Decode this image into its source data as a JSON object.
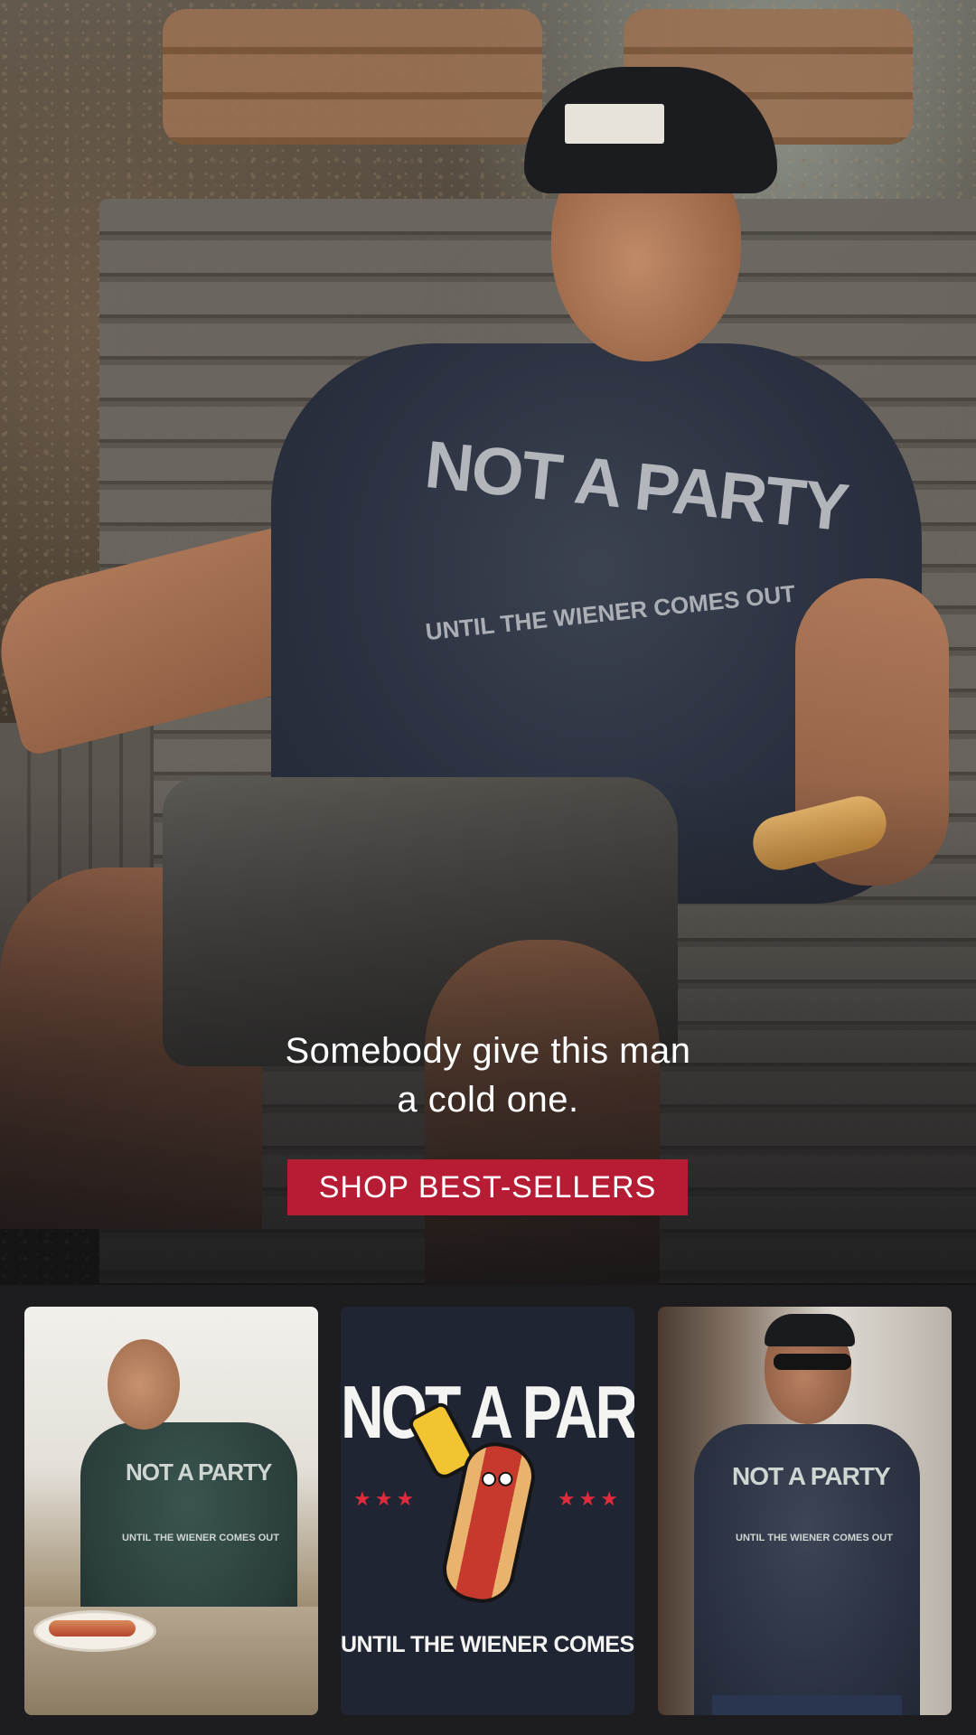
{
  "hero": {
    "shirt_graphic_title": "NOT A PARTY",
    "shirt_graphic_subtitle": "UNTIL THE WIENER COMES OUT",
    "caption_line1": "Somebody give this man",
    "caption_line2": "a cold one.",
    "cta_label": "SHOP BEST-SELLERS"
  },
  "thumbnails": [
    {
      "graphic_title": "NOT A PARTY",
      "graphic_subtitle": "UNTIL THE WIENER COMES OUT"
    },
    {
      "graphic_title": "NOT A PARTY",
      "graphic_subtitle": "UNTIL THE WIENER COMES OUT"
    },
    {
      "graphic_title": "NOT A PARTY",
      "graphic_subtitle": "UNTIL THE WIENER COMES OUT"
    }
  ],
  "colors": {
    "cta_background": "#b71c35",
    "page_background": "#1d1d1f",
    "graphic_tile_background": "#1f2533",
    "star_red": "#e02b3d"
  }
}
